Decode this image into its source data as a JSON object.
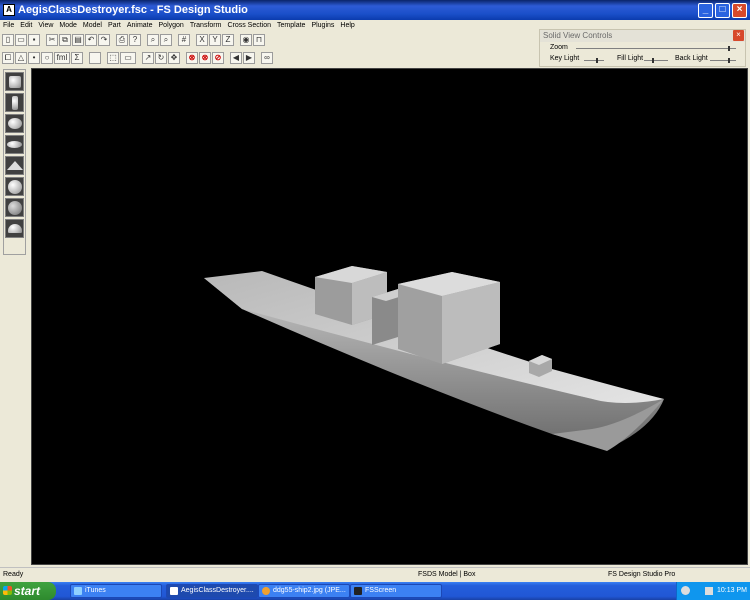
{
  "window": {
    "title": "AegisClassDestroyer.fsc - FS Design Studio"
  },
  "menu": [
    "File",
    "Edit",
    "View",
    "Mode",
    "Model",
    "Part",
    "Animate",
    "Polygon",
    "Transform",
    "Cross Section",
    "Template",
    "Plugins",
    "Help"
  ],
  "toolbar1": [
    "new-icon",
    "open-icon",
    "save-icon",
    "cut-icon",
    "copy-icon",
    "paste-icon",
    "undo-icon",
    "redo-icon",
    "print-icon",
    "help-icon",
    "zoom-in-icon",
    "zoom-out-icon",
    "grid-icon",
    "scale-x-icon",
    "scale-y-icon",
    "scale-z-icon",
    "eye-icon",
    "lock-icon"
  ],
  "toolbar2": [
    "select-icon",
    "triangle-icon",
    "point-icon",
    "circle-icon",
    "fml-label-icon",
    "sigma-icon",
    "blank-icon",
    "dotted-box-icon",
    "dash-box-icon",
    "arrow-icon",
    "rotate-icon",
    "move-icon",
    "stop1-icon",
    "stop2-icon",
    "stop3-icon",
    "left-arrow-icon",
    "right-arrow-icon",
    "binoculars-icon"
  ],
  "toolbar2_labels": {
    "fml": "fml",
    "sigma": "Σ"
  },
  "solid_view": {
    "title": "Solid View Controls",
    "zoom_label": "Zoom",
    "key_light_label": "Key Light",
    "fill_light_label": "Fill Light",
    "back_light_label": "Back Light"
  },
  "palette": [
    "cube-icon",
    "cylinder-icon",
    "sphere-flat-icon",
    "disc-icon",
    "cone-icon",
    "sphere-icon",
    "globe-icon",
    "dome-icon"
  ],
  "status": {
    "left": "Ready",
    "model": "FSDS Model | Box",
    "app": "FS Design Studio Pro"
  },
  "taskbar": {
    "start": "start",
    "tasks": [
      {
        "label": "iTunes"
      },
      {
        "label": "AegisClassDestroyer...."
      },
      {
        "label": "ddg55-ship2.jpg (JPE..."
      },
      {
        "label": "FSScreen"
      }
    ],
    "clock": "10:13 PM"
  }
}
